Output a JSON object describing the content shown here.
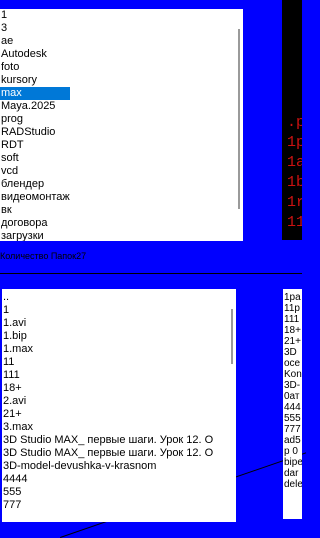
{
  "colors": {
    "background": "#0000ff",
    "selection": "#0078d7",
    "console_bg": "#000000",
    "console_text": "#cc1111"
  },
  "folder_list": {
    "items": [
      {
        "label": "1"
      },
      {
        "label": "3"
      },
      {
        "label": "ae"
      },
      {
        "label": "Autodesk"
      },
      {
        "label": "foto"
      },
      {
        "label": "kursory"
      },
      {
        "label": "max",
        "selected": true
      },
      {
        "label": "Maya.2025"
      },
      {
        "label": "prog"
      },
      {
        "label": "RADStudio"
      },
      {
        "label": "RDT"
      },
      {
        "label": "soft"
      },
      {
        "label": "vcd"
      },
      {
        "label": "блендер"
      },
      {
        "label": "видеомонтаж"
      },
      {
        "label": "вк"
      },
      {
        "label": "договора"
      },
      {
        "label": "загрузки"
      }
    ]
  },
  "status": {
    "folder_count": "Количество Папок27"
  },
  "console": {
    "lines": [
      ".p",
      "1p",
      "1a",
      "1b",
      "1r",
      "11"
    ]
  },
  "file_list": {
    "items": [
      "..",
      "1",
      "1.avi",
      "1.bip",
      "1.max",
      "11",
      "111",
      "18+",
      "2.avi",
      "21+",
      "3.max",
      "3D Studio MAX_ первые шаги. Урок 12. О",
      "3D Studio MAX_ первые шаги. Урок 12. О",
      "3D-model-devushka-v-krasnom",
      "4444",
      "555",
      "777"
    ]
  },
  "right_list": {
    "items": [
      "1ра",
      "11р",
      "111",
      "18+",
      "21+",
      "3D",
      "осе",
      "Kon",
      "3D-",
      "0ат",
      "444",
      "555",
      "777",
      "ad5",
      "p 0",
      "bipe",
      "dar",
      "dele"
    ]
  }
}
